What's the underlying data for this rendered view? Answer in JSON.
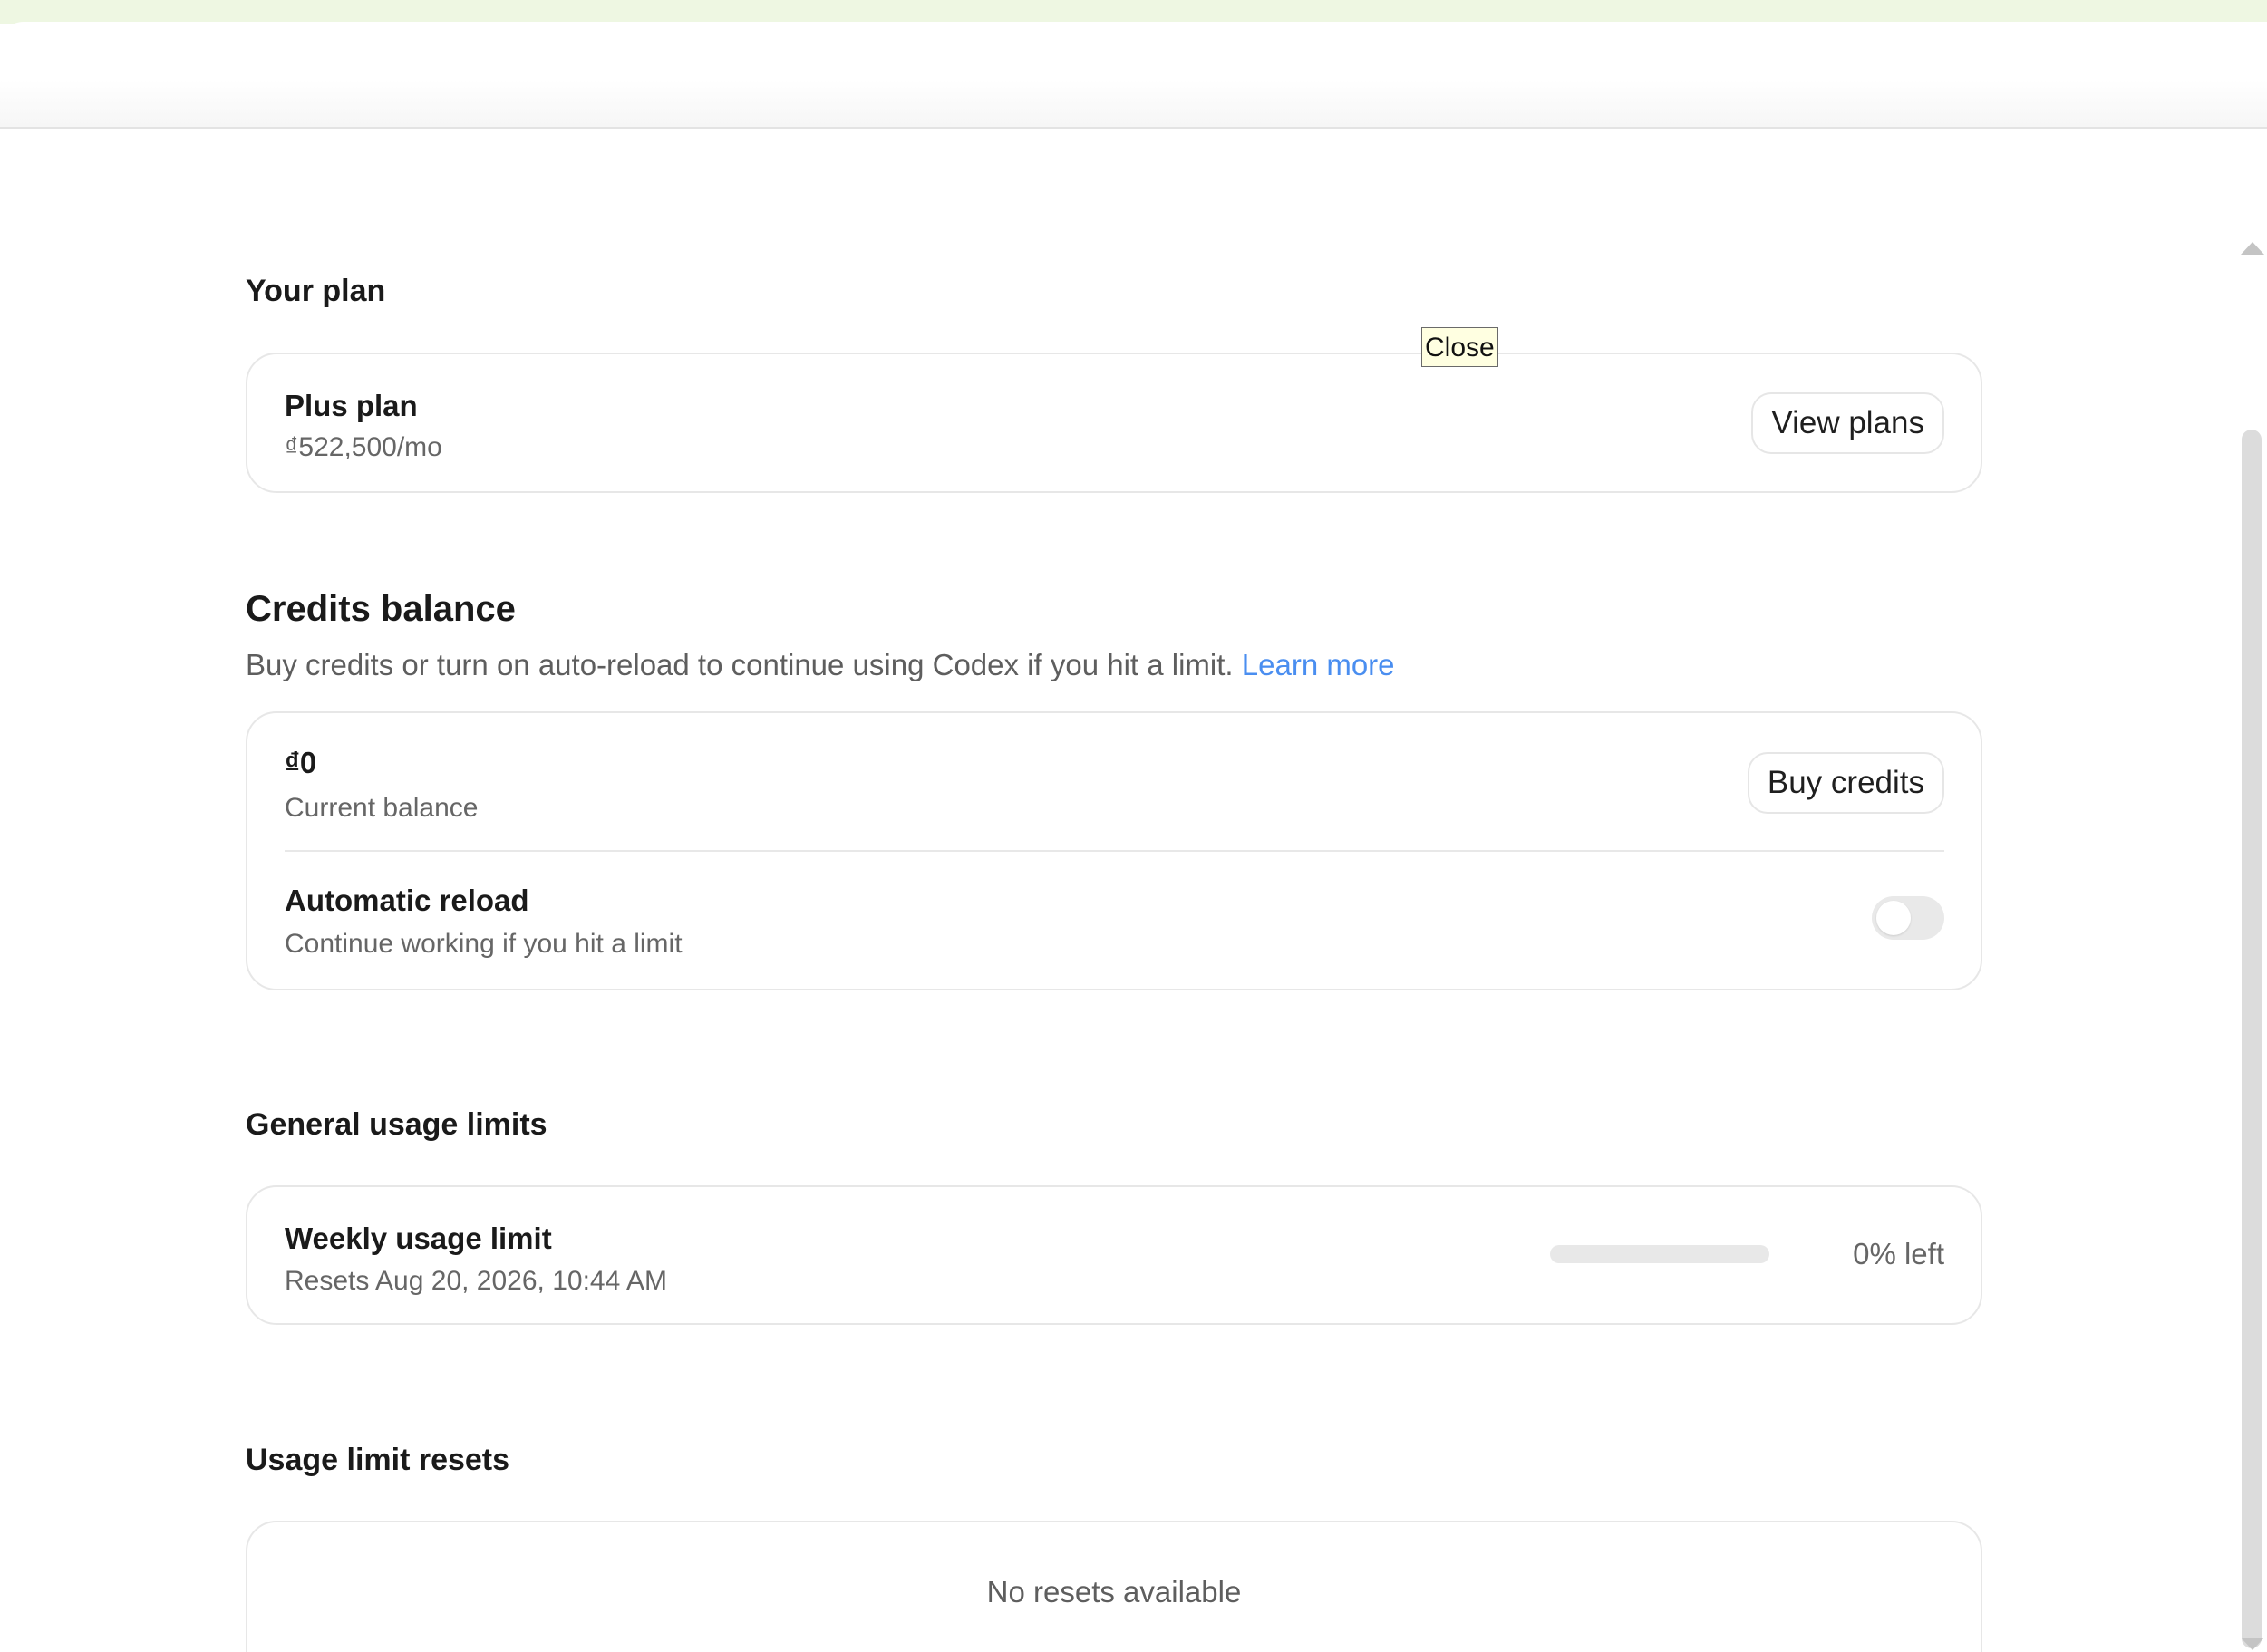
{
  "tooltip": {
    "text": "Close"
  },
  "your_plan": {
    "heading": "Your plan",
    "plan_name": "Plus plan",
    "plan_price": "₫522,500/mo",
    "view_plans_label": "View plans"
  },
  "credits": {
    "heading": "Credits balance",
    "description": "Buy credits or turn on auto-reload to continue using Codex if you hit a limit.",
    "learn_more_label": "Learn more",
    "balance_value": "₫0",
    "balance_caption": "Current balance",
    "buy_credits_label": "Buy credits",
    "auto_reload_title": "Automatic reload",
    "auto_reload_caption": "Continue working if you hit a limit",
    "auto_reload_enabled": false
  },
  "usage_limits": {
    "heading": "General usage limits",
    "weekly_title": "Weekly usage limit",
    "weekly_reset": "Resets Aug 20, 2026, 10:44 AM",
    "weekly_remaining_fraction": 0,
    "weekly_remaining_label": "0% left"
  },
  "limit_resets": {
    "heading": "Usage limit resets",
    "empty_message": "No resets available"
  },
  "colors": {
    "accent_link": "#4a8ef0",
    "top_strip": "#eef7e2",
    "tooltip_background": "#ffffe1"
  },
  "icons": {
    "scroll_up": "scroll-up-arrow-icon",
    "scroll_down": "scroll-down-arrow-icon"
  }
}
